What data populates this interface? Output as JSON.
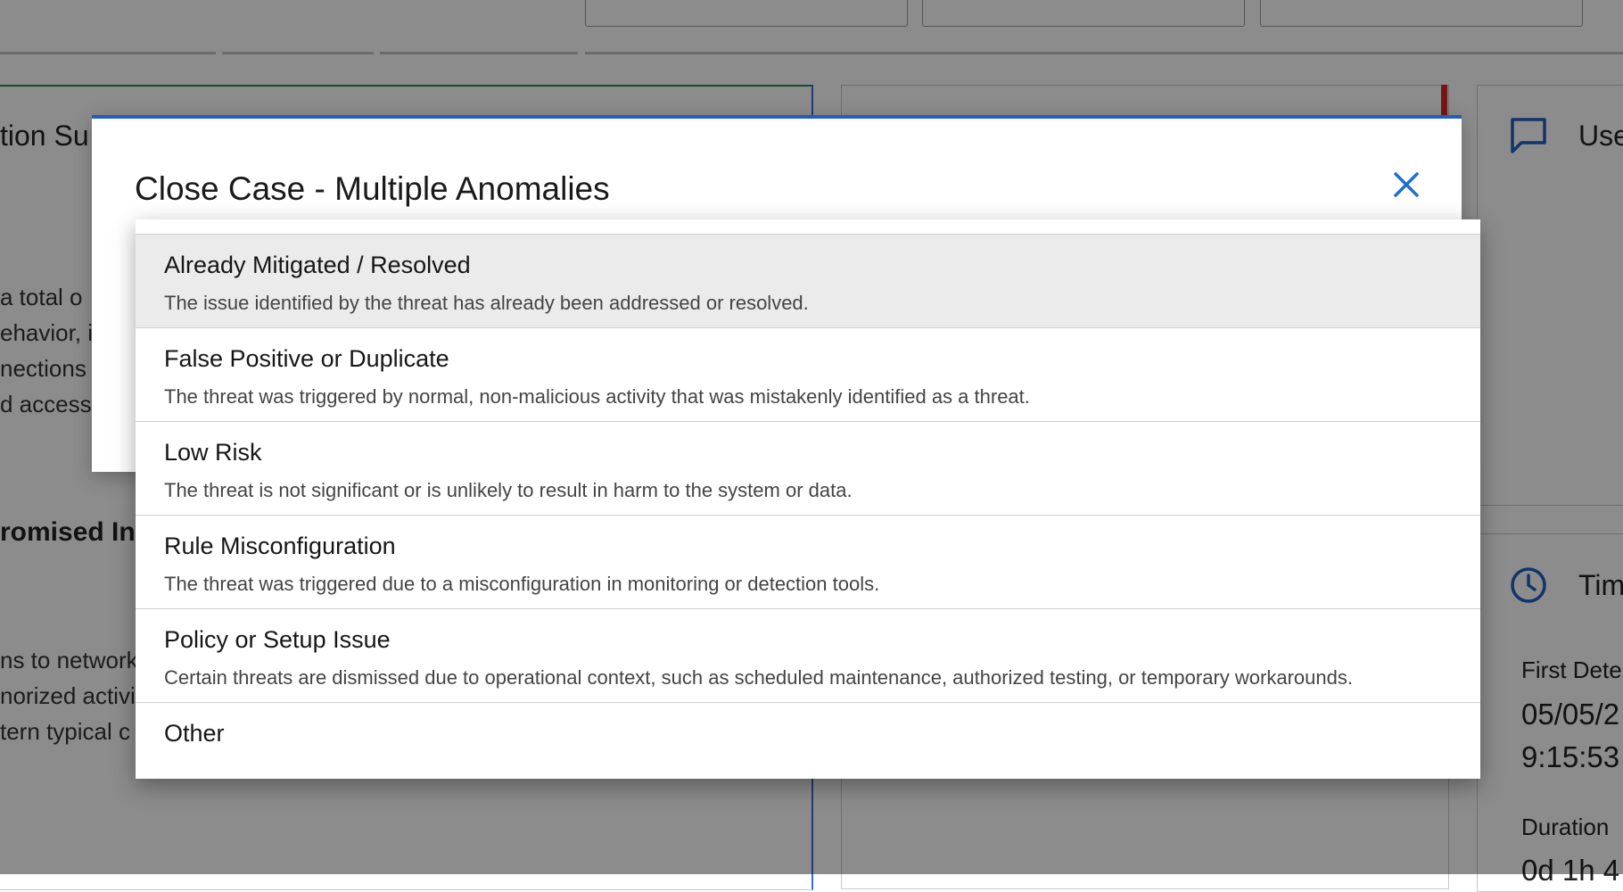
{
  "background": {
    "summary_heading": "tion Su",
    "summary_lines": [
      "a total o",
      "ehavior, i",
      "nections",
      "d access"
    ],
    "compromised_heading": "romised In",
    "compromised_lines": [
      "ns to network",
      "norized activi",
      "tern typical c"
    ],
    "user_panel_title": "Use",
    "timeline_panel_title": "Tim",
    "first_detected_label": "First Dete",
    "first_detected_date": "05/05/2",
    "first_detected_time": "9:15:53",
    "duration_label": "Duration",
    "duration_value": "0d 1h 4"
  },
  "modal": {
    "title": "Close Case - Multiple Anomalies",
    "close_icon": "close-icon",
    "accent_color": "#1f5fbf"
  },
  "dropdown": {
    "selected_index": 0,
    "options": [
      {
        "title": "Already Mitigated / Resolved",
        "description": "The issue identified by the threat has already been addressed or resolved."
      },
      {
        "title": "False Positive or Duplicate",
        "description": "The threat was triggered by normal, non-malicious activity that was mistakenly identified as a threat."
      },
      {
        "title": "Low Risk",
        "description": "The threat is not significant or is unlikely to result in harm to the system or data."
      },
      {
        "title": "Rule Misconfiguration",
        "description": "The threat was triggered due to a misconfiguration in monitoring or detection tools."
      },
      {
        "title": "Policy or Setup Issue",
        "description": "Certain threats are dismissed due to operational context, such as scheduled maintenance, authorized testing, or temporary workarounds."
      },
      {
        "title": "Other",
        "description": ""
      }
    ]
  }
}
